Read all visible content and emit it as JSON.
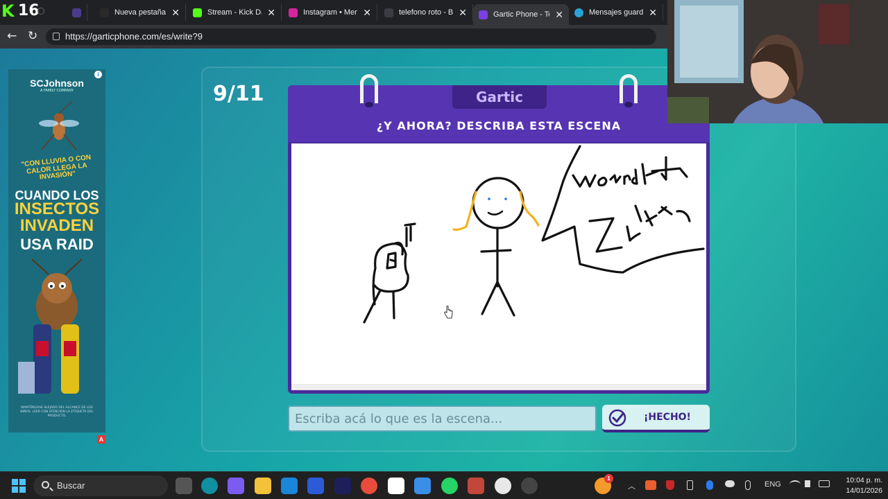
{
  "browser": {
    "kick_count": "16",
    "tabs": [
      {
        "title": "Nueva pestaña",
        "favicon_color": "#2a2a2a"
      },
      {
        "title": "Stream - Kick Dash",
        "favicon_color": "#53fc18"
      },
      {
        "title": "Instagram • Mensa",
        "favicon_color": "#d6249f"
      },
      {
        "title": "telefono roto - Bús",
        "favicon_color": "#3c3c44"
      },
      {
        "title": "Gartic Phone - Tele",
        "favicon_color": "#7b3fe4"
      },
      {
        "title": "Mensajes guardad",
        "favicon_color": "#2aa3d8"
      }
    ],
    "close_glyph": "✕",
    "url": "https://garticphone.com/es/write?9"
  },
  "ad": {
    "brand": "SCJohnson",
    "brand_sub": "A FAMILY COMPANY",
    "quote": "\"CON LLUVIA O CON CALOR LLEGA LA INVASIÓN\"",
    "line1": "CUANDO LOS",
    "line2": "INSECTOS INVADEN",
    "line3": "USA RAID",
    "fine_print": "MANTÉNGASE ALEJADO DEL ALCANCE DE LOS NIÑOS. LEER CON ATENCIÓN LA ETIQUETA DEL PRODUCTO.",
    "info_glyph": "i",
    "menu_glyph": "⋮",
    "badge": "A"
  },
  "game": {
    "round": "9/11",
    "logo": "Gartic",
    "prompt": "¿Y AHORA? DESCRIBA ESTA ESCENA",
    "input_placeholder": "Escriba acá lo que es la escena...",
    "done_label": "¡HECHO!"
  },
  "taskbar": {
    "search_label": "Buscar",
    "lang": "ENG",
    "time": "10:04 p. m.",
    "date": "14/01/2026",
    "notification_count": "1"
  }
}
